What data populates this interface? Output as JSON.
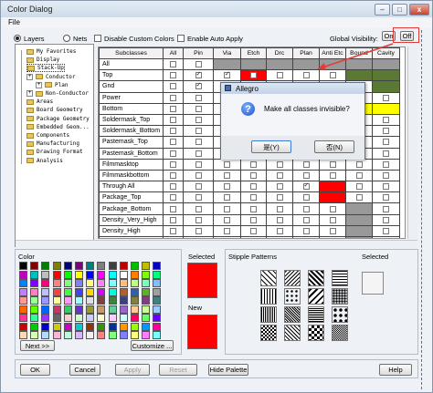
{
  "window": {
    "title": "Color Dialog",
    "menu_file": "File",
    "btn_min": "–",
    "btn_max": "□",
    "btn_close": "x"
  },
  "top": {
    "layers": "Layers",
    "nets": "Nets",
    "disable_custom": "Disable Custom Colors",
    "enable_auto": "Enable Auto Apply",
    "global_visibility": "Global Visibility:",
    "on": "On",
    "off": "Off"
  },
  "tree": {
    "items": [
      {
        "label": "My Favorites",
        "level": 1
      },
      {
        "label": "Display",
        "level": 1
      },
      {
        "label": "Stack-Up",
        "level": 1,
        "expanded": true,
        "selected": true
      },
      {
        "label": "Conductor",
        "level": 2
      },
      {
        "label": "Plan",
        "level": 3
      },
      {
        "label": "Non-Conductor",
        "level": 2
      },
      {
        "label": "Areas",
        "level": 1
      },
      {
        "label": "Board Geometry",
        "level": 1
      },
      {
        "label": "Package Geometry",
        "level": 1
      },
      {
        "label": "Embedded Geom...",
        "level": 1
      },
      {
        "label": "Components",
        "level": 1
      },
      {
        "label": "Manufacturing",
        "level": 1
      },
      {
        "label": "Drawing Format",
        "level": 1
      },
      {
        "label": "Analysis",
        "level": 1
      }
    ]
  },
  "grid": {
    "columns": [
      "Subclasses",
      "All",
      "Pin",
      "Via",
      "Etch",
      "Drc",
      "Plan",
      "Anti Etc",
      "Bound",
      "Cavity"
    ],
    "rows": [
      {
        "name": "All",
        "cells": [
          "n",
          "g",
          "g",
          "g",
          "g",
          "g",
          "g",
          "g"
        ]
      },
      {
        "name": "Top",
        "cells": [
          "y",
          "y",
          "c-y",
          "e",
          "e",
          "e",
          "cg",
          "cg"
        ]
      },
      {
        "name": "Gnd",
        "cells": [
          "y",
          "y",
          "c",
          "e",
          "e",
          "e",
          "e",
          "cg"
        ]
      },
      {
        "name": "Power",
        "cells": [
          "n",
          "y",
          "r",
          "e",
          "e",
          "e",
          "e",
          "e"
        ]
      },
      {
        "name": "Bottom",
        "cells": [
          "n",
          "y",
          "y",
          "e",
          "e",
          "e",
          "cy",
          "cy"
        ]
      },
      {
        "name": "Soldermask_Top",
        "cells": [
          "n",
          "y",
          "e",
          "e",
          "e",
          "e",
          "e",
          "e"
        ]
      },
      {
        "name": "Soldermask_Bottom",
        "cells": [
          "n",
          "y",
          "e",
          "e",
          "e",
          "e",
          "e",
          "e"
        ]
      },
      {
        "name": "Pastemask_Top",
        "cells": [
          "n",
          "e",
          "e",
          "e",
          "e",
          "e",
          "e",
          "e"
        ]
      },
      {
        "name": "Pastemask_Bottom",
        "cells": [
          "n",
          "e",
          "e",
          "e",
          "e",
          "e",
          "e",
          "e"
        ]
      },
      {
        "name": "Filmmasktop",
        "cells": [
          "n",
          "e",
          "e",
          "e",
          "e",
          "e",
          "e",
          "e"
        ]
      },
      {
        "name": "Filmmaskbottom",
        "cells": [
          "n",
          "e",
          "e",
          "e",
          "e",
          "e",
          "e",
          "e"
        ]
      },
      {
        "name": "Through All",
        "cells": [
          "n",
          "e",
          "e",
          "e",
          "y",
          "r",
          "c",
          "c"
        ]
      },
      {
        "name": "Package_Top",
        "cells": [
          "n",
          "e",
          "e",
          "e",
          "c",
          "r",
          "c",
          "e"
        ]
      },
      {
        "name": "Package_Bottom",
        "cells": [
          "n",
          "e",
          "e",
          "e",
          "e",
          "e",
          "g",
          "e"
        ]
      },
      {
        "name": "Density_Very_High",
        "cells": [
          "n",
          "e",
          "e",
          "e",
          "e",
          "e",
          "g",
          "e"
        ]
      },
      {
        "name": "Density_High",
        "cells": [
          "n",
          "e",
          "e",
          "e",
          "e",
          "e",
          "g",
          "e"
        ]
      },
      {
        "name": "Density_Medium",
        "cells": [
          "n",
          "e",
          "e",
          "e",
          "e",
          "e",
          "g",
          "e"
        ]
      },
      {
        "name": "Density_Low",
        "cells": [
          "n",
          "e",
          "e",
          "e",
          "e",
          "e",
          "g",
          "e"
        ]
      }
    ]
  },
  "colors": {
    "green": "#5a7a34",
    "yellow": "#ffff00",
    "red": "#ff0000",
    "gray": "#999999",
    "selected": "#ff0000",
    "new": "#ff0000"
  },
  "palette": {
    "label": "Color",
    "next": "Next >>",
    "customize": "Customize ...",
    "swatches": [
      "#000000",
      "#7f0000",
      "#007f00",
      "#7f7f00",
      "#00007f",
      "#7f007f",
      "#007f7f",
      "#7f7f7f",
      "#3f3f3f",
      "#bf0000",
      "#00bf00",
      "#bfbf00",
      "#0000bf",
      "#bf00bf",
      "#00bfbf",
      "#bfbfbf",
      "#ff0000",
      "#00ff00",
      "#ffff00",
      "#0000ff",
      "#ff00ff",
      "#00ffff",
      "#ffffff",
      "#ff7f00",
      "#7fff00",
      "#00ff7f",
      "#007fff",
      "#7f00ff",
      "#ff007f",
      "#ff7f7f",
      "#7fff7f",
      "#7f7fff",
      "#ffff7f",
      "#ff7fff",
      "#7fffff",
      "#ffbf7f",
      "#bfff7f",
      "#7fffbf",
      "#7fbfff",
      "#bf7fff",
      "#ff7fbf",
      "#c0c0ff",
      "#ff4040",
      "#40ff40",
      "#4040ff",
      "#ffd800",
      "#d800ff",
      "#00ffd8",
      "#b06030",
      "#3060b0",
      "#60b030",
      "#a0a0a0",
      "#ff9999",
      "#99ff99",
      "#9999ff",
      "#ffff99",
      "#ff99ff",
      "#99ffff",
      "#e0e0e0",
      "#804040",
      "#408040",
      "#404080",
      "#808040",
      "#804080",
      "#408080",
      "#ff6600",
      "#66ff00",
      "#0066ff",
      "#cc3366",
      "#33cc66",
      "#6633cc",
      "#999933",
      "#cc9966",
      "#66cc99",
      "#9966cc",
      "#ffcc99",
      "#ccff99",
      "#99ccff",
      "#ff3399",
      "#33ff99",
      "#9933ff",
      "#666666",
      "#ffcccc",
      "#ccffcc",
      "#ccccff",
      "#ffffcc",
      "#ffccff",
      "#ccffff",
      "#ff0066",
      "#66ff66",
      "#6600ff",
      "#cc0000",
      "#00cc00",
      "#0000cc",
      "#cccc00",
      "#cc00cc",
      "#00cccc",
      "#993300",
      "#339900",
      "#003399",
      "#ff9900",
      "#99ff00",
      "#0099ff",
      "#ff0099",
      "#ffd9b3",
      "#d9ffb3",
      "#b3d9ff",
      "#ffb3d9",
      "#b3ffd9",
      "#d9b3ff",
      "#f0f0f0",
      "#ff8080",
      "#80ff80",
      "#8080ff",
      "#ffff80",
      "#ff80ff",
      "#80ffff"
    ]
  },
  "selected_label": "Selected",
  "new_label": "New",
  "stipple": {
    "label": "Stipple Patterns",
    "selected": "Selected"
  },
  "footer": {
    "ok": "OK",
    "cancel": "Cancel",
    "apply": "Apply",
    "reset": "Reset",
    "hide_palette": "Hide Palette",
    "help": "Help"
  },
  "popup": {
    "title": "Allegro",
    "message": "Make all classes invisible?",
    "yes": "是(Y)",
    "no": "否(N)"
  }
}
